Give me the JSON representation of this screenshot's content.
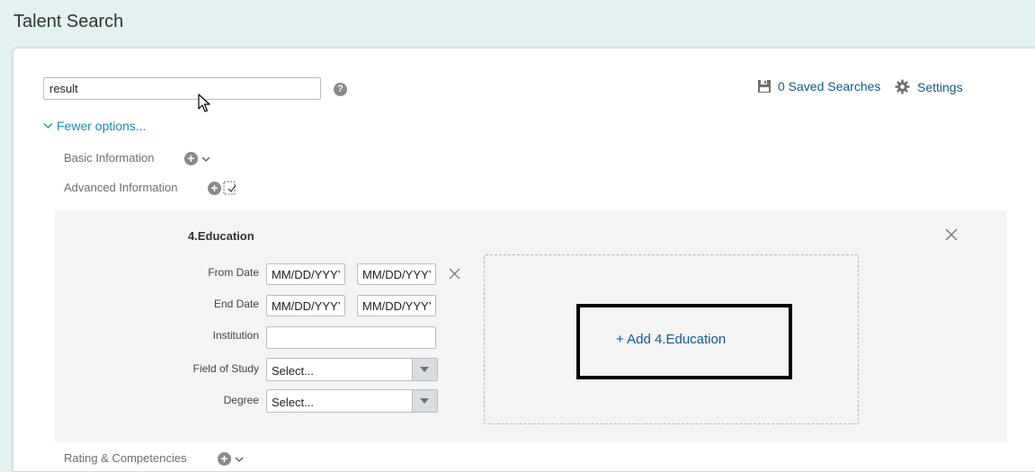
{
  "page_title": "Talent Search",
  "search": {
    "value": "result"
  },
  "help_icon_text": "?",
  "header_links": {
    "saved_searches": "0 Saved Searches",
    "settings": "Settings"
  },
  "fewer_options": "Fewer options...",
  "sections": {
    "basic_information": "Basic Information",
    "advanced_information": "Advanced Information",
    "rating_competencies": "Rating & Competencies"
  },
  "plus_symbol": "+",
  "education": {
    "title": "4.Education",
    "from_date_label": "From Date",
    "end_date_label": "End Date",
    "institution_label": "Institution",
    "field_of_study_label": "Field of Study",
    "degree_label": "Degree",
    "date_value": "MM/DD/YYYY",
    "select_value": "Select...",
    "add_button": "+ Add 4.Education"
  },
  "colors": {
    "background": "#e3f1f1",
    "link": "#135a8c",
    "accent_link": "#1a8ab8"
  },
  "icons": [
    "help-icon",
    "save-icon",
    "gear-icon",
    "chevron-down-icon",
    "add-icon",
    "select-fields-icon",
    "close-icon",
    "mouse-cursor-icon"
  ]
}
